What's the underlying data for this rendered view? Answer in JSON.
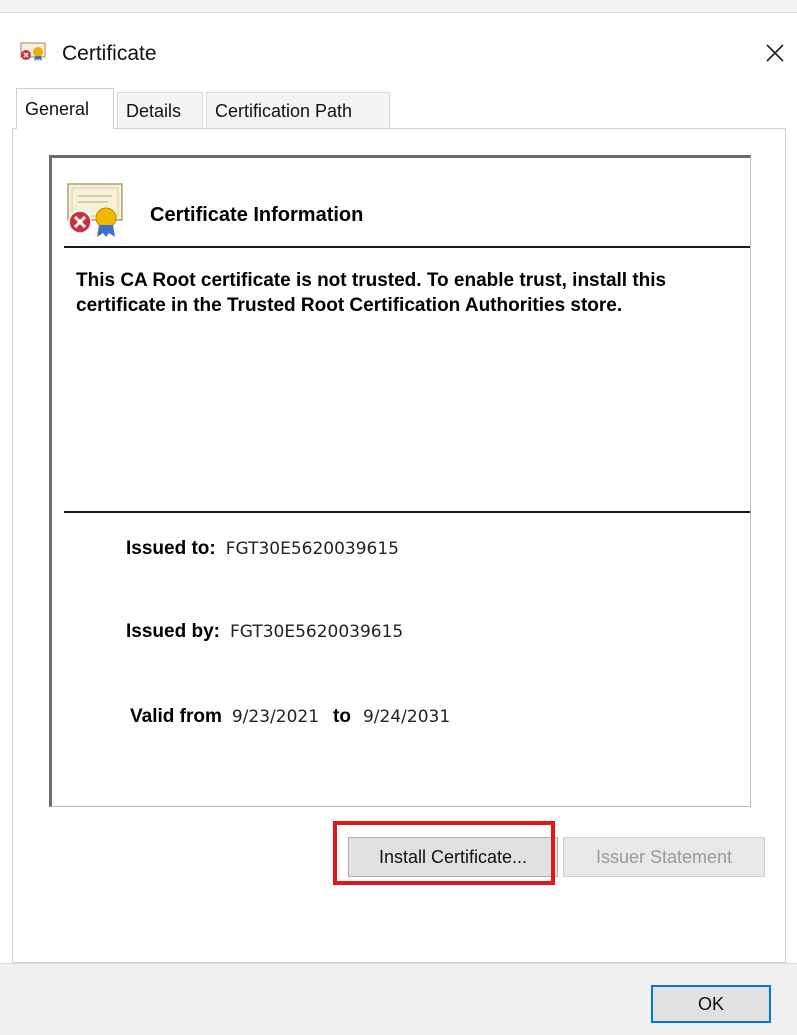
{
  "window": {
    "title": "Certificate",
    "close_label": "×"
  },
  "tabs": [
    {
      "label": "General",
      "active": true
    },
    {
      "label": "Details",
      "active": false
    },
    {
      "label": "Certification Path",
      "active": false
    }
  ],
  "info": {
    "heading": "Certificate Information",
    "message": "This CA Root certificate is not trusted. To enable trust, install this certificate in the Trusted Root Certification Authorities store.",
    "issued_to_label": "Issued to:",
    "issued_to_value": "FGT30E5620039615",
    "issued_by_label": "Issued by:",
    "issued_by_value": "FGT30E5620039615",
    "valid_from_label": "Valid from",
    "valid_from_value": "9/23/2021",
    "valid_to_label": "to",
    "valid_to_value": "9/24/2031"
  },
  "buttons": {
    "install": "Install Certificate...",
    "issuer": "Issuer Statement",
    "ok": "OK"
  },
  "icons": {
    "window": "certificate-icon",
    "info": "certificate-untrusted-icon",
    "close": "close-icon"
  },
  "colors": {
    "highlight": "#e4141b",
    "ok_border": "#0078d7",
    "error_badge": "#c9323a"
  }
}
